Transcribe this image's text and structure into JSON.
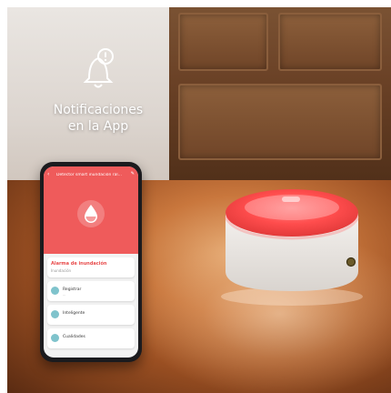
{
  "headline": {
    "line1": "Notificaciones",
    "line2": "en la App"
  },
  "phone": {
    "app_title": "Detector smart inundación ral...",
    "alarm_title": "Alarma de inundación",
    "alarm_sub": "Inundación",
    "rows": [
      {
        "label": "Registrar",
        "hint": "···"
      },
      {
        "label": "Inteligente"
      },
      {
        "label": "Cualidades"
      }
    ],
    "accent": "#ef5b5b"
  },
  "icons": [
    "bell-alert-icon",
    "water-drop-icon",
    "back-arrow-icon",
    "edit-icon"
  ],
  "colors": {
    "sensor_glow": "#ff4d4d",
    "floor": "#c9773d",
    "cabinet": "#6a4126"
  }
}
